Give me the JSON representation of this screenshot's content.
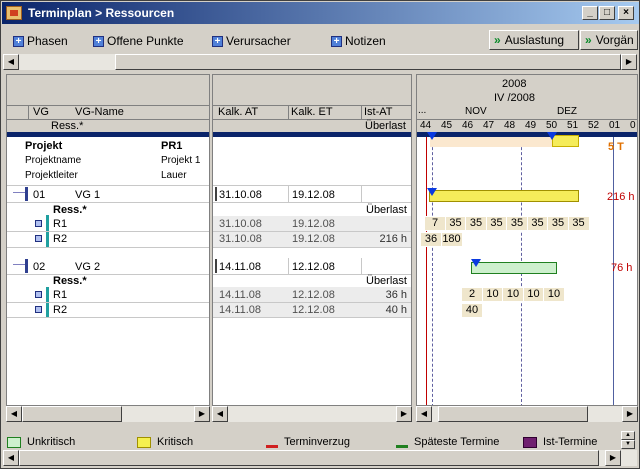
{
  "window": {
    "title": "Terminplan > Ressourcen",
    "min": "_",
    "max": "□",
    "close": "×"
  },
  "toolbar": {
    "left": [
      {
        "label": "Phasen"
      },
      {
        "label": "Offene Punkte"
      },
      {
        "label": "Verursacher"
      },
      {
        "label": "Notizen"
      }
    ],
    "right": [
      {
        "label": "Auslastung"
      },
      {
        "label": "Vorgän"
      }
    ]
  },
  "table": {
    "headers": {
      "vg": "VG",
      "vgname": "VG-Name",
      "ress": "Ress.*",
      "kalk_at": "Kalk. AT",
      "kalk_et": "Kalk. ET",
      "ist_at": "Ist-AT",
      "ueberlast": "Überlast"
    },
    "project": {
      "projekt_label": "Projekt",
      "projekt_value": "PR1",
      "name_label": "Projektname",
      "name_value": "Projekt 1",
      "leiter_label": "Projektleiter",
      "leiter_value": "Lauer"
    },
    "groups": [
      {
        "vg": "01",
        "name": "VG 1",
        "at": "31.10.08",
        "et": "19.12.08",
        "ress_label": "Ress.*",
        "ueberlast_label": "Überlast",
        "rows": [
          {
            "name": "R1",
            "at": "31.10.08",
            "et": "19.12.08",
            "ueberlast": ""
          },
          {
            "name": "R2",
            "at": "31.10.08",
            "et": "19.12.08",
            "ueberlast": "216 h"
          }
        ],
        "gantt_total": "216 h"
      },
      {
        "vg": "02",
        "name": "VG 2",
        "at": "14.11.08",
        "et": "12.12.08",
        "ress_label": "Ress.*",
        "ueberlast_label": "Überlast",
        "rows": [
          {
            "name": "R1",
            "at": "14.11.08",
            "et": "12.12.08",
            "ueberlast": "36 h"
          },
          {
            "name": "R2",
            "at": "14.11.08",
            "et": "12.12.08",
            "ueberlast": "40 h"
          }
        ],
        "gantt_total": "76 h"
      }
    ]
  },
  "gantt": {
    "year": "2008",
    "quarter": "IV /2008",
    "dots": "...",
    "months": [
      "NOV",
      "DEZ"
    ],
    "weeks": [
      "44",
      "45",
      "46",
      "47",
      "48",
      "49",
      "50",
      "51",
      "52",
      "01",
      "0"
    ],
    "project_total": "5 T",
    "g1_r1": [
      "7",
      "35",
      "35",
      "35",
      "35",
      "35",
      "35",
      "35"
    ],
    "g1_r2": [
      "36",
      "180"
    ],
    "g2_r1": [
      "2",
      "10",
      "10",
      "10",
      "10"
    ],
    "g2_r2": [
      "40"
    ]
  },
  "legend": [
    {
      "label": "Unkritisch",
      "color": "#cdf0cd"
    },
    {
      "label": "Kritisch",
      "color": "#f5f050"
    },
    {
      "label": "Terminverzug",
      "color": "#d02020"
    },
    {
      "label": "Späteste Termine",
      "color": "#208020"
    },
    {
      "label": "Ist-Termine",
      "color": "#702070"
    }
  ],
  "colors": {
    "uncritical": "#cdf0cd",
    "critical": "#f5ec5a",
    "project_bar": "#fbe8cf",
    "milestone": "#0a3ae0",
    "today": "#c00000"
  }
}
